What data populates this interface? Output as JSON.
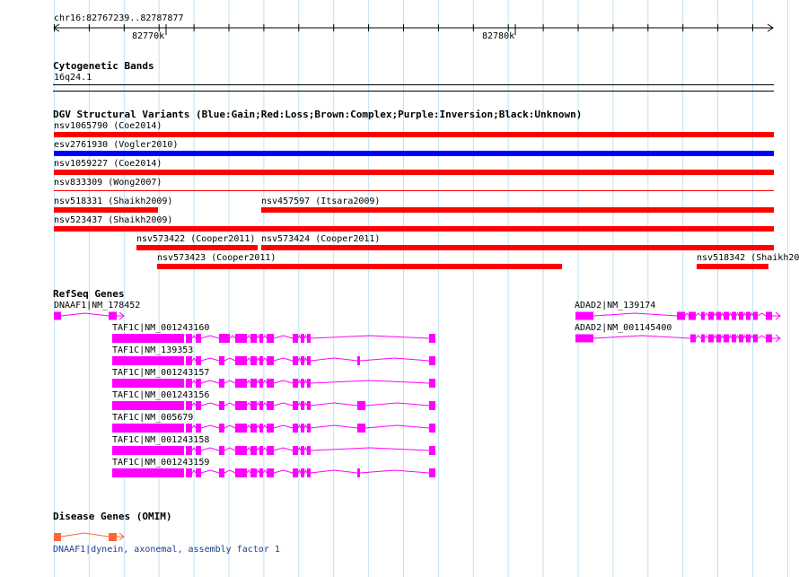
{
  "ruler": {
    "region_label": "chr16:82767239..82787877",
    "ticks": [
      "82770k",
      "82780k"
    ]
  },
  "cytoband": {
    "title": "Cytogenetic Bands",
    "band_label": "16q24.1"
  },
  "dgv": {
    "title": "DGV Structural Variants (Blue:Gain;Red:Loss;Brown:Complex;Purple:Inversion;Black:Unknown)",
    "variants": [
      {
        "label": "nsv1065790 (Coe2014)",
        "type": "loss",
        "color": "#ff0000"
      },
      {
        "label": "esv2761930 (Vogler2010)",
        "type": "gain",
        "color": "#0000ff"
      },
      {
        "label": "nsv1059227 (Coe2014)",
        "type": "loss",
        "color": "#ff0000"
      },
      {
        "label": "nsv833309 (Wong2007)",
        "type": "loss",
        "color": "#ff0000"
      },
      {
        "label": "nsv518331 (Shaikh2009)",
        "type": "loss",
        "color": "#ff0000"
      },
      {
        "label": "nsv457597 (Itsara2009)",
        "type": "loss",
        "color": "#ff0000"
      },
      {
        "label": "nsv523437 (Shaikh2009)",
        "type": "loss",
        "color": "#ff0000"
      },
      {
        "label": "nsv573422 (Cooper2011)",
        "type": "loss",
        "color": "#ff0000"
      },
      {
        "label": "nsv573424 (Cooper2011)",
        "type": "loss",
        "color": "#ff0000"
      },
      {
        "label": "nsv573423 (Cooper2011)",
        "type": "loss",
        "color": "#ff0000"
      },
      {
        "label": "nsv518342 (Shaikh20",
        "type": "loss",
        "color": "#ff0000"
      }
    ]
  },
  "refseq": {
    "title": "RefSeq Genes",
    "color": "#ff00ff",
    "genes": [
      {
        "label": "DNAAF1|NM_178452"
      },
      {
        "label": "TAF1C|NM_001243160"
      },
      {
        "label": "TAF1C|NM_139353"
      },
      {
        "label": "TAF1C|NM_001243157"
      },
      {
        "label": "TAF1C|NM_001243156"
      },
      {
        "label": "TAF1C|NM_005679"
      },
      {
        "label": "TAF1C|NM_001243158"
      },
      {
        "label": "TAF1C|NM_001243159"
      },
      {
        "label": "ADAD2|NM_139174"
      },
      {
        "label": "ADAD2|NM_001145400"
      }
    ]
  },
  "disease": {
    "title": "Disease Genes (OMIM)",
    "color": "#ff6633",
    "label": "DNAAF1|dynein, axonemal, assembly factor 1"
  },
  "colors": {
    "grid": "#bfe3f3",
    "gain": "#0000ff",
    "loss": "#ff0000",
    "gene": "#ff00ff",
    "omim": "#ff6633",
    "omim_text": "#1a3c8c"
  }
}
